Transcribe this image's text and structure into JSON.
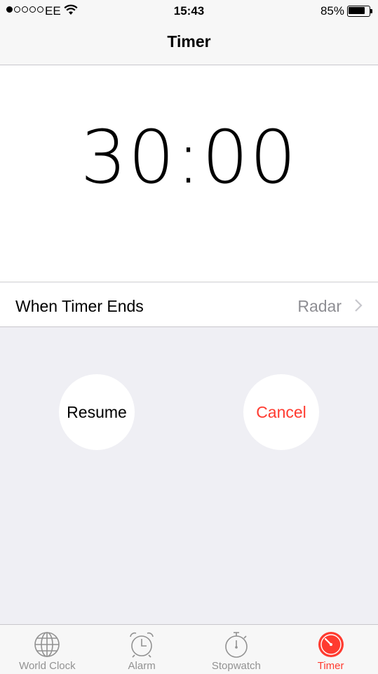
{
  "status_bar": {
    "signal_filled": 1,
    "signal_total": 5,
    "carrier": "EE",
    "time": "15:43",
    "battery_percent": "85%",
    "battery_level": 0.85
  },
  "nav": {
    "title": "Timer"
  },
  "timer": {
    "display": "30:00"
  },
  "ends_row": {
    "label": "When Timer Ends",
    "value": "Radar"
  },
  "buttons": {
    "resume": "Resume",
    "cancel": "Cancel"
  },
  "tabbar": {
    "tabs": [
      {
        "label": "World Clock",
        "icon": "globe-icon",
        "active": false
      },
      {
        "label": "Alarm",
        "icon": "alarm-clock-icon",
        "active": false
      },
      {
        "label": "Stopwatch",
        "icon": "stopwatch-icon",
        "active": false
      },
      {
        "label": "Timer",
        "icon": "timer-icon",
        "active": true
      }
    ]
  },
  "colors": {
    "accent": "#ff3b30",
    "inactive": "#929292",
    "background": "#efeff4"
  }
}
